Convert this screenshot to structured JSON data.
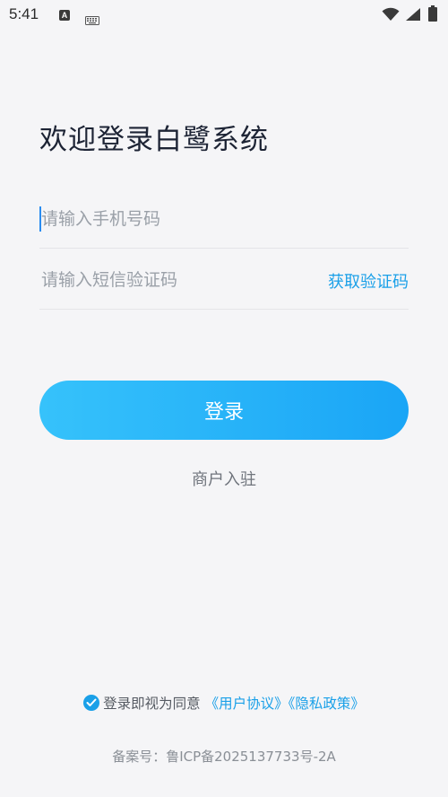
{
  "status_bar": {
    "time": "5:41",
    "a_badge": "A",
    "icons": [
      "keyboard-icon",
      "wifi-icon",
      "signal-icon",
      "battery-icon"
    ]
  },
  "title": "欢迎登录白鹭系统",
  "form": {
    "phone_placeholder": "请输入手机号码",
    "code_placeholder": "请输入短信验证码",
    "get_code_label": "获取验证码"
  },
  "login_button_label": "登录",
  "merchant_link_label": "商户入驻",
  "agreement": {
    "checked": true,
    "prefix": "登录即视为同意",
    "user_agreement": "《用户协议》",
    "privacy_policy": "《隐私政策》"
  },
  "icp_text": "备案号：鲁ICP备2025137733号-2A",
  "colors": {
    "accent": "#1aa0e8",
    "button_gradient_start": "#36c2fb",
    "button_gradient_end": "#1aa5f6",
    "background": "#f5f5f7"
  }
}
